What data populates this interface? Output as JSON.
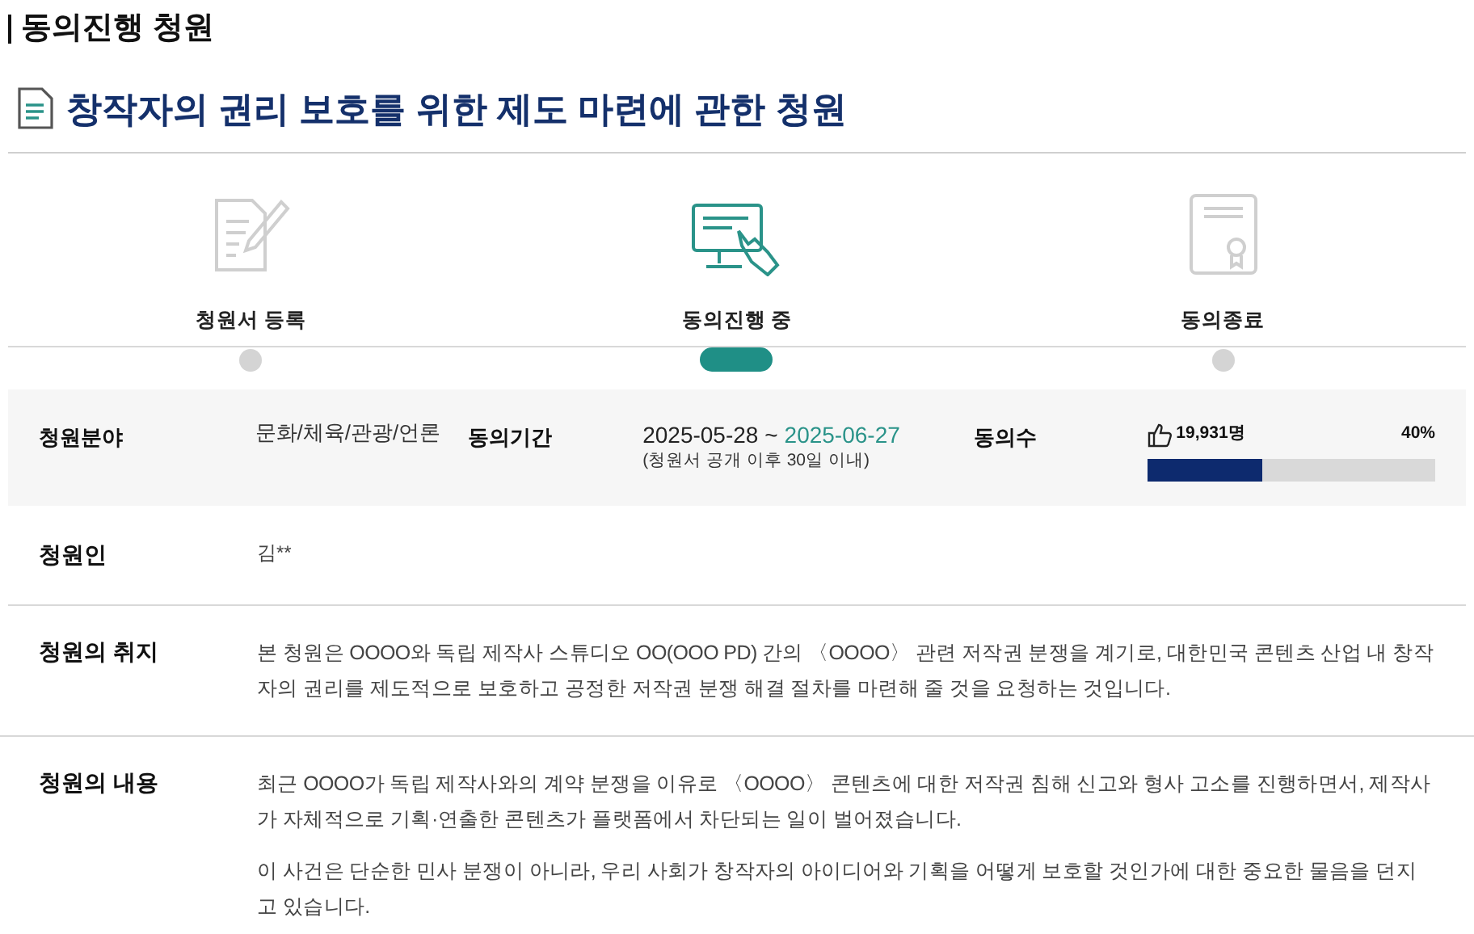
{
  "section_title": "동의진행 청원",
  "petition_title": "창작자의 권리 보호를 위한 제도 마련에 관한 청원",
  "steps": [
    {
      "label": "청원서 등록",
      "kind": "register",
      "selected": false
    },
    {
      "label": "동의진행 중",
      "kind": "progress",
      "selected": true
    },
    {
      "label": "동의종료",
      "kind": "closed",
      "selected": false
    }
  ],
  "info": {
    "field_label": "청원분야",
    "field_value": "문화/체육/관광/언론",
    "period_label": "동의기간",
    "period_start": "2025-05-28 ~",
    "period_end": "2025-06-27",
    "period_note": "(청원서 공개 이후 30일 이내)",
    "count_label": "동의수",
    "count": "19,931명",
    "percent": "40%",
    "level": 0.4
  },
  "petitioner": {
    "label": "청원인",
    "value": "김**"
  },
  "purpose": {
    "label": "청원의 취지",
    "paragraphs": [
      "본 청원은 OOOO와 독립 제작사 스튜디오 OO(OOO PD) 간의 〈OOOO〉 관련 저작권 분쟁을 계기로, 대한민국 콘텐츠 산업 내 창작자의 권리를 제도적으로 보호하고 공정한 저작권 분쟁 해결 절차를 마련해 줄 것을 요청하는 것입니다."
    ]
  },
  "content": {
    "label": "청원의 내용",
    "paragraphs": [
      "최근 OOOO가 독립 제작사와의 계약 분쟁을 이유로 〈OOOO〉 콘텐츠에 대한 저작권 침해 신고와 형사 고소를 진행하면서, 제작사가 자체적으로 기획·연출한 콘텐츠가 플랫폼에서 차단되는 일이 벌어졌습니다.",
      "이 사건은 단순한 민사 분쟁이 아니라, 우리 사회가 창작자의 아이디어와 기획을 어떻게 보호할 것인가에 대한 중요한 물음을 던지고 있습니다."
    ]
  }
}
